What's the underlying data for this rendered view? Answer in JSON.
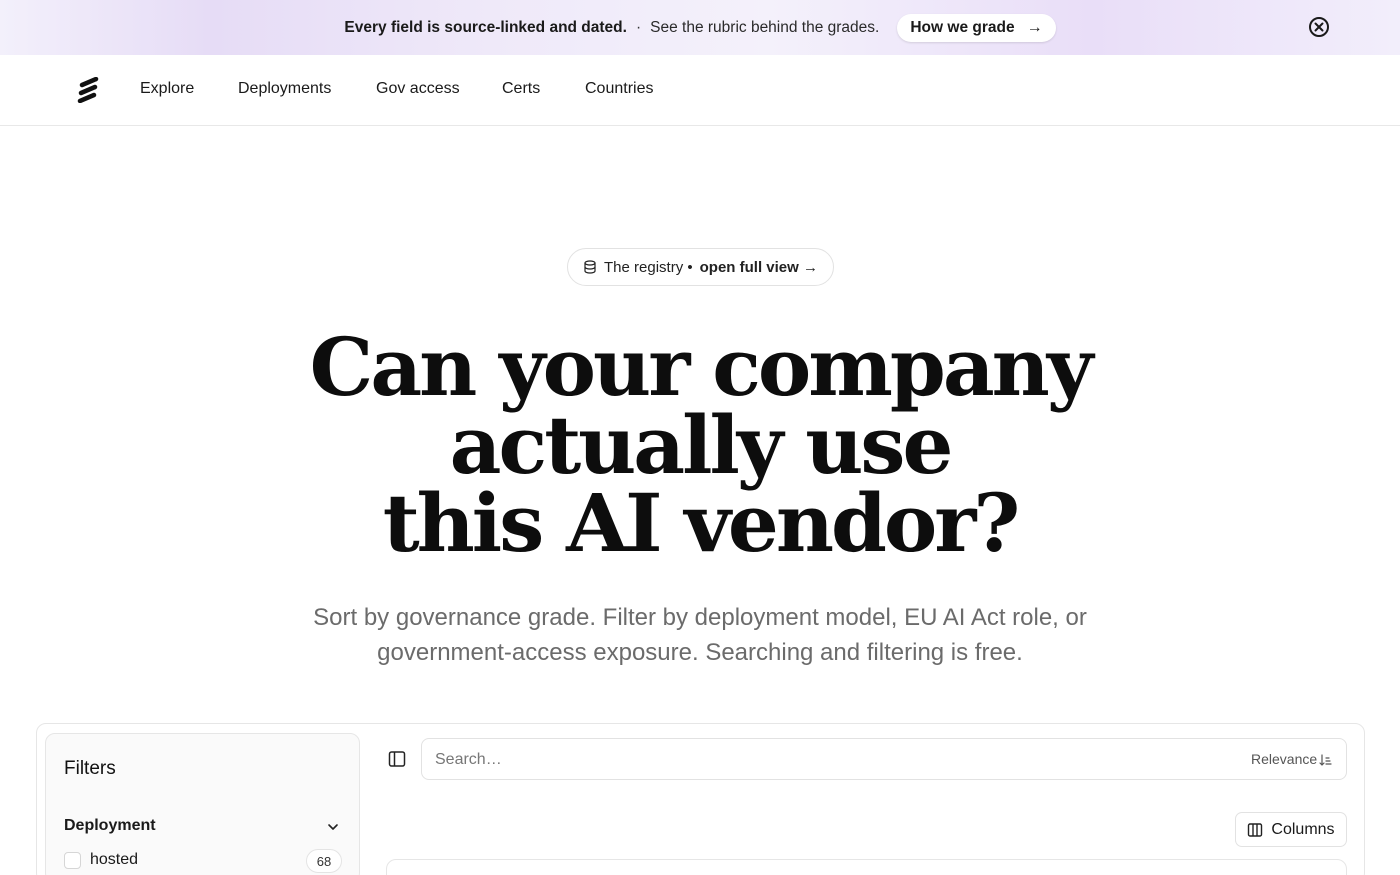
{
  "banner": {
    "bold_text": "Every field is source-linked and dated.",
    "separator": "·",
    "text": "See the rubric behind the grades.",
    "button_label": "How we grade",
    "button_arrow": "→"
  },
  "nav": {
    "items": [
      {
        "label": "Explore"
      },
      {
        "label": "Deployments"
      },
      {
        "label": "Gov access"
      },
      {
        "label": "Certs"
      },
      {
        "label": "Countries"
      }
    ]
  },
  "pill": {
    "text": "The registry •",
    "link_text": "open full view →",
    "icon": "database-icon"
  },
  "headline": {
    "line1": "Can your company",
    "line2": "actually use",
    "line3": "this AI vendor?"
  },
  "subhead": {
    "line1": "Sort by governance grade. Filter by deployment model, EU AI Act role, or",
    "line2": "government-access exposure. Searching and filtering is free."
  },
  "filters": {
    "title": "Filters",
    "groups": [
      {
        "label": "Deployment",
        "options": [
          {
            "label": "hosted",
            "count": "68",
            "checked": false
          }
        ]
      }
    ]
  },
  "search": {
    "placeholder": "Search…",
    "value": "",
    "sort_label": "Relevance"
  },
  "toolbar": {
    "columns_label": "Columns"
  },
  "colors": {
    "banner_gradient_accent": "#e6dcf6",
    "text_primary": "#111111",
    "text_muted": "#6b6b6b",
    "border": "#e6e6e6"
  }
}
